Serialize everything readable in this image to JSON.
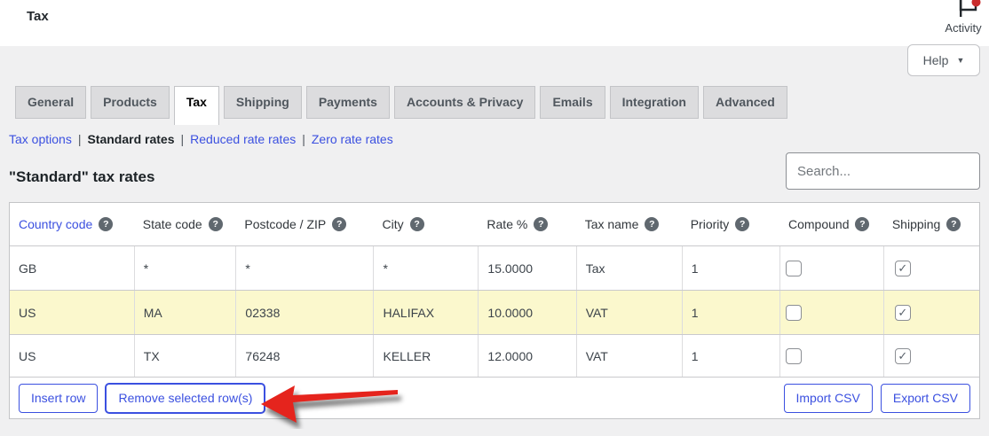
{
  "topbar": {
    "title": "Tax",
    "activity_label": "Activity"
  },
  "help": {
    "label": "Help"
  },
  "tabs": [
    {
      "label": "General",
      "active": false
    },
    {
      "label": "Products",
      "active": false
    },
    {
      "label": "Tax",
      "active": true
    },
    {
      "label": "Shipping",
      "active": false
    },
    {
      "label": "Payments",
      "active": false
    },
    {
      "label": "Accounts & Privacy",
      "active": false
    },
    {
      "label": "Emails",
      "active": false
    },
    {
      "label": "Integration",
      "active": false
    },
    {
      "label": "Advanced",
      "active": false
    }
  ],
  "subnav": {
    "separator": "|",
    "items": [
      {
        "label": "Tax options",
        "current": false
      },
      {
        "label": "Standard rates",
        "current": true
      },
      {
        "label": "Reduced rate rates",
        "current": false
      },
      {
        "label": "Zero rate rates",
        "current": false
      }
    ]
  },
  "section": {
    "title": "\"Standard\" tax rates"
  },
  "search": {
    "placeholder": "Search..."
  },
  "table": {
    "columns": [
      {
        "label": "Country code",
        "help": true
      },
      {
        "label": "State code",
        "help": true
      },
      {
        "label": "Postcode / ZIP",
        "help": true
      },
      {
        "label": "City",
        "help": true
      },
      {
        "label": "Rate %",
        "help": true
      },
      {
        "label": "Tax name",
        "help": true
      },
      {
        "label": "Priority",
        "help": true
      },
      {
        "label": "Compound",
        "help": true
      },
      {
        "label": "Shipping",
        "help": true
      }
    ],
    "rows": [
      {
        "country_code": "GB",
        "state_code": "*",
        "postcode": "*",
        "city": "*",
        "rate": "15.0000",
        "tax_name": "Tax",
        "priority": "1",
        "compound": false,
        "shipping": true,
        "highlighted": false
      },
      {
        "country_code": "US",
        "state_code": "MA",
        "postcode": "02338",
        "city": "HALIFAX",
        "rate": "10.0000",
        "tax_name": "VAT",
        "priority": "1",
        "compound": false,
        "shipping": true,
        "highlighted": true
      },
      {
        "country_code": "US",
        "state_code": "TX",
        "postcode": "76248",
        "city": "KELLER",
        "rate": "12.0000",
        "tax_name": "VAT",
        "priority": "1",
        "compound": false,
        "shipping": true,
        "highlighted": false
      }
    ],
    "actions": {
      "insert": "Insert row",
      "remove": "Remove selected row(s)",
      "import": "Import CSV",
      "export": "Export CSV"
    }
  },
  "annotation": {
    "type": "arrow",
    "points_to": "Remove selected row(s)",
    "color": "#e5241d"
  },
  "icons": {
    "help_glyph": "?",
    "check_glyph": "✓",
    "caret_down": "▼"
  },
  "colors": {
    "accent": "#3b50e0",
    "body_bg": "#f0f0f1",
    "topbar_bg": "#ffffff",
    "tab_bg": "#dcdcde",
    "border": "#c3c4c7",
    "highlight_row": "#fbf8cd",
    "arrow": "#e5241d",
    "notification_dot": "#c92c2c"
  }
}
